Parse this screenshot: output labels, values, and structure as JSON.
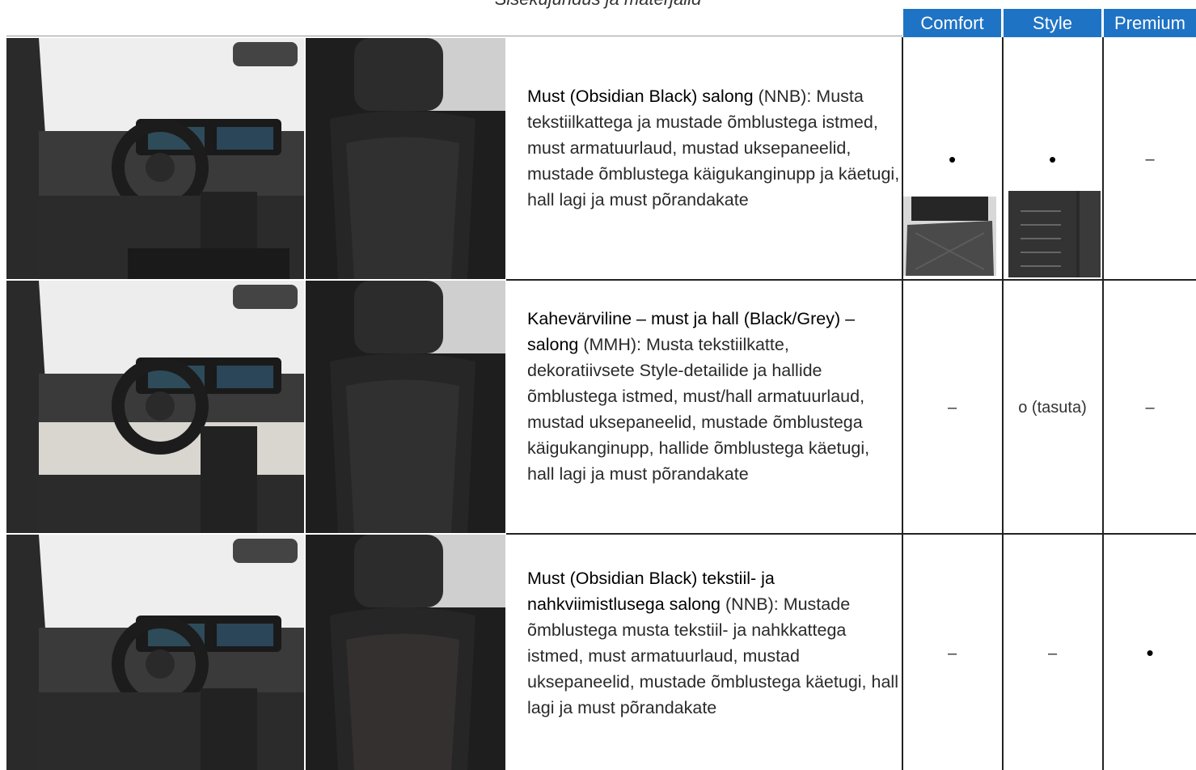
{
  "caption": "Sisekujundus ja materjalid",
  "columns": [
    "Comfort",
    "Style",
    "Premium"
  ],
  "rows": [
    {
      "title": "Must (Obsidian Black) salong",
      "code": "(NNB):",
      "text": "Musta tekstiilkattega ja mustade õmblustega istmed, must armatuurlaud, mustad uksepaneelid, mustade õmblustega käigukanginupp ja käetugi, hall lagi ja must põrandakate",
      "comfort": "•",
      "style": "•",
      "premium": "–"
    },
    {
      "title": "Kahevärviline – must ja hall (Black/Grey) – salong",
      "code": "(MMH):",
      "text": "Musta tekstiilkatte, dekoratiivsete Style-detailide ja hallide õmblustega istmed, must/hall armatuurlaud, mustad uksepaneelid, mustade õmblustega käigukanginupp, hallide õmblustega käetugi, hall lagi ja must põrandakate",
      "comfort": "–",
      "style": "o (tasuta)",
      "premium": "–"
    },
    {
      "title": "Must (Obsidian Black) tekstiil- ja nahkviimistlusega salong",
      "code": "(NNB):",
      "text": "Mustade õmblustega musta tekstiil- ja nahkkattega istmed, must armatuurlaud, mustad uksepaneelid, mustade õmblustega käetugi, hall lagi ja must põrandakate",
      "comfort": "–",
      "style": "–",
      "premium": "•"
    }
  ]
}
